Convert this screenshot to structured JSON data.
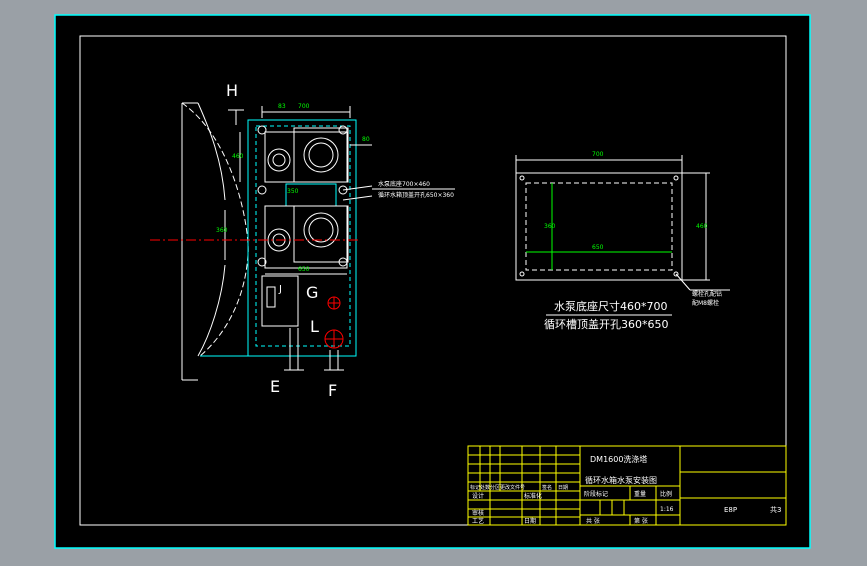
{
  "colors": {
    "frame_outer": "#9aa0a6",
    "paper": "#000000",
    "cyan": "#00ffff",
    "white": "#ffffff",
    "yellow": "#ffff00",
    "green": "#00ff00",
    "red": "#ff0000"
  },
  "drawing": {
    "view_labels": {
      "H": "H",
      "E": "E",
      "F": "F",
      "G": "G",
      "L": "L",
      "J": "J"
    },
    "dims_left": {
      "top_width": "700",
      "top_offset": "83",
      "left_height_top": "460",
      "right_small": "80",
      "left_height_mid": "360",
      "gap": "350",
      "bottom_width": "650"
    },
    "callouts": {
      "line1": "水泵底座700×460",
      "line2": "循环水箱顶盖开孔650×360"
    },
    "plate": {
      "width_label": "700",
      "height_label": "460",
      "inner_width": "650",
      "inner_height": "360",
      "note_line1": "螺栓孔配钻",
      "note_line2": "配M8螺栓"
    },
    "notes": {
      "line1": "水泵底座尺寸460*700",
      "line2": "循环槽顶盖开孔360*650"
    }
  },
  "title_block": {
    "machine_name": "DM1600洗涤塔",
    "drawing_title": "循环水箱水泵安装图",
    "design": "设计",
    "standardization": "标准化",
    "process": "工艺",
    "review": "审核",
    "date": "日期",
    "stage_mark": "阶段标记",
    "weight": "重量",
    "scale_header": "比例",
    "scale": "1:16",
    "sheets_total": "共  张",
    "sheet_no": "第  张",
    "code": "E8P",
    "sheet_of": "共3",
    "rev_mark": "标记",
    "rev_count": "处数",
    "rev_zone": "分区",
    "rev_doc": "更改文件号",
    "rev_sign": "签名",
    "rev_date": "日期"
  }
}
